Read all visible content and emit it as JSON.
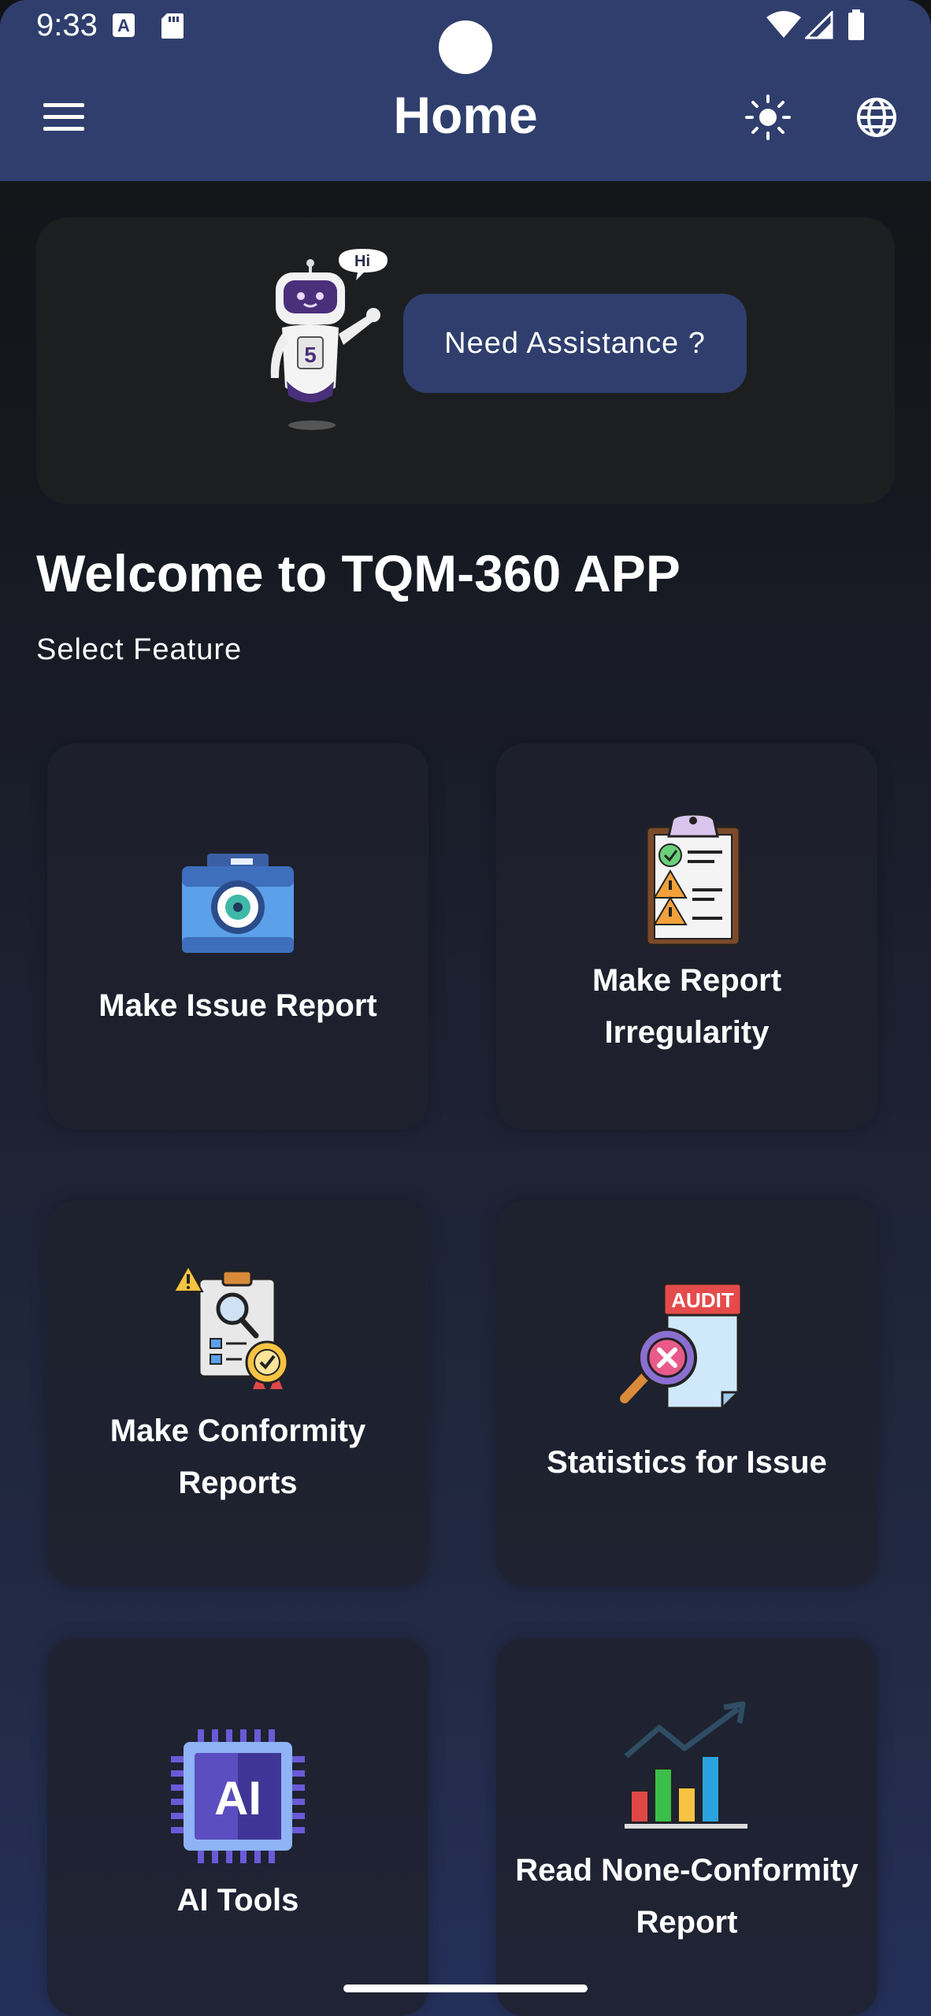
{
  "status_bar": {
    "time": "9:33",
    "icons": [
      "a-keyboard-icon",
      "sd-card-icon",
      "wifi-icon",
      "cell-signal-icon",
      "battery-icon"
    ]
  },
  "app_bar": {
    "title": "Home",
    "menu_icon": "hamburger-menu-icon",
    "theme_icon": "sun-icon",
    "language_icon": "globe-icon",
    "color": "#2f3e6d"
  },
  "assistance": {
    "bubble_text": "Hi",
    "button_label": "Need Assistance ?"
  },
  "welcome": {
    "title": "Welcome to TQM-360 APP",
    "subtitle": "Select Feature"
  },
  "features": [
    {
      "label": "Make Issue Report",
      "icon": "camera-icon"
    },
    {
      "label": "Make Report Irregularity",
      "icon": "clipboard-warning-icon"
    },
    {
      "label": "Make Conformity Reports",
      "icon": "conformity-checklist-icon"
    },
    {
      "label": "Statistics for Issue",
      "icon": "audit-magnifier-icon"
    },
    {
      "label": "AI Tools",
      "icon": "ai-chip-icon"
    },
    {
      "label": "Read None-Conformity Report",
      "icon": "bar-chart-trend-icon"
    }
  ],
  "audit_text": "AUDIT",
  "ai_text": "AI"
}
